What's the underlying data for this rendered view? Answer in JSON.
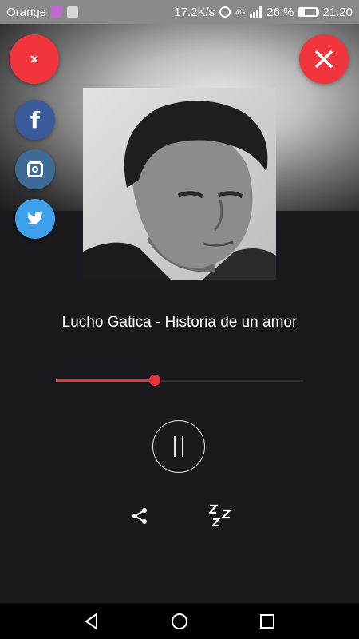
{
  "status_bar": {
    "carrier": "Orange",
    "speed": "17.2K/s",
    "network": "4G",
    "battery": "26 %",
    "time": "21:20"
  },
  "player": {
    "track_title": "Lucho Gatica - Historia de un amor",
    "progress": 0.4,
    "state": "playing"
  },
  "buttons": {
    "close_small_icon": "close-icon",
    "close_big_icon": "close-icon",
    "social": [
      "facebook-icon",
      "instagram-icon",
      "twitter-icon"
    ],
    "share_icon": "share-icon",
    "sleep_icon": "sleep-timer-icon"
  },
  "colors": {
    "accent": "#f0353d",
    "background": "#1a191e",
    "facebook": "#3b5a99",
    "instagram": "#3e6b95",
    "twitter": "#3ea1ec"
  }
}
